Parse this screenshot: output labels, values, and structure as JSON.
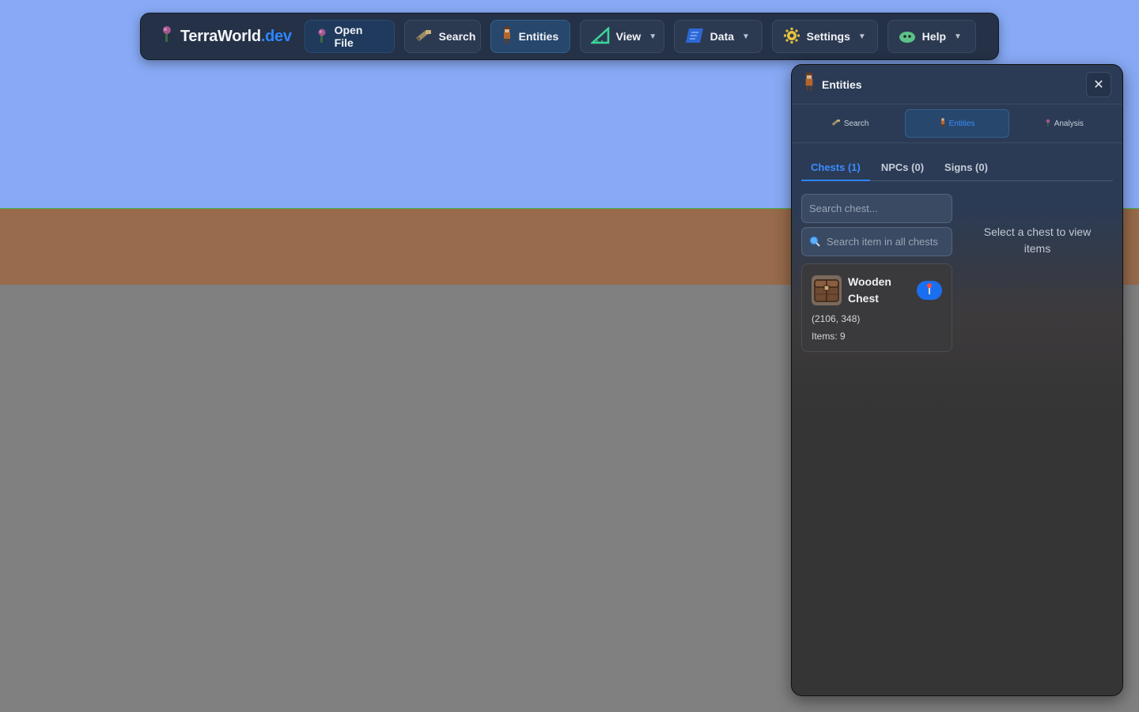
{
  "toolbar": {
    "brand_main": "TerraWorld",
    "brand_suffix": ".dev",
    "open_file": "Open File",
    "search": "Search",
    "entities": "Entities",
    "view": "View",
    "data": "Data",
    "settings": "Settings",
    "help": "Help",
    "caret": "▼"
  },
  "panel": {
    "title": "Entities",
    "close": "✕",
    "tabs": [
      {
        "label": "Search",
        "icon": "drill-icon"
      },
      {
        "label": "Entities",
        "icon": "guide-icon"
      },
      {
        "label": "Analysis",
        "icon": "bloom-icon"
      }
    ],
    "subtabs": [
      "Chests (1)",
      "NPCs (0)",
      "Signs (0)"
    ],
    "search_chest_placeholder": "Search chest...",
    "search_item_placeholder": "Search item in all chests",
    "chest": {
      "name": "Wooden Chest",
      "coords": "(2106, 348)",
      "items": "Items: 9"
    },
    "empty_message": "Select a chest to view items"
  },
  "colors": {
    "sky": "#88aaf6",
    "dirt": "#976b4b",
    "stone": "#808080",
    "grass": "#44b34a",
    "accent": "#2f86ff",
    "toolbar_bg": "#243146"
  }
}
